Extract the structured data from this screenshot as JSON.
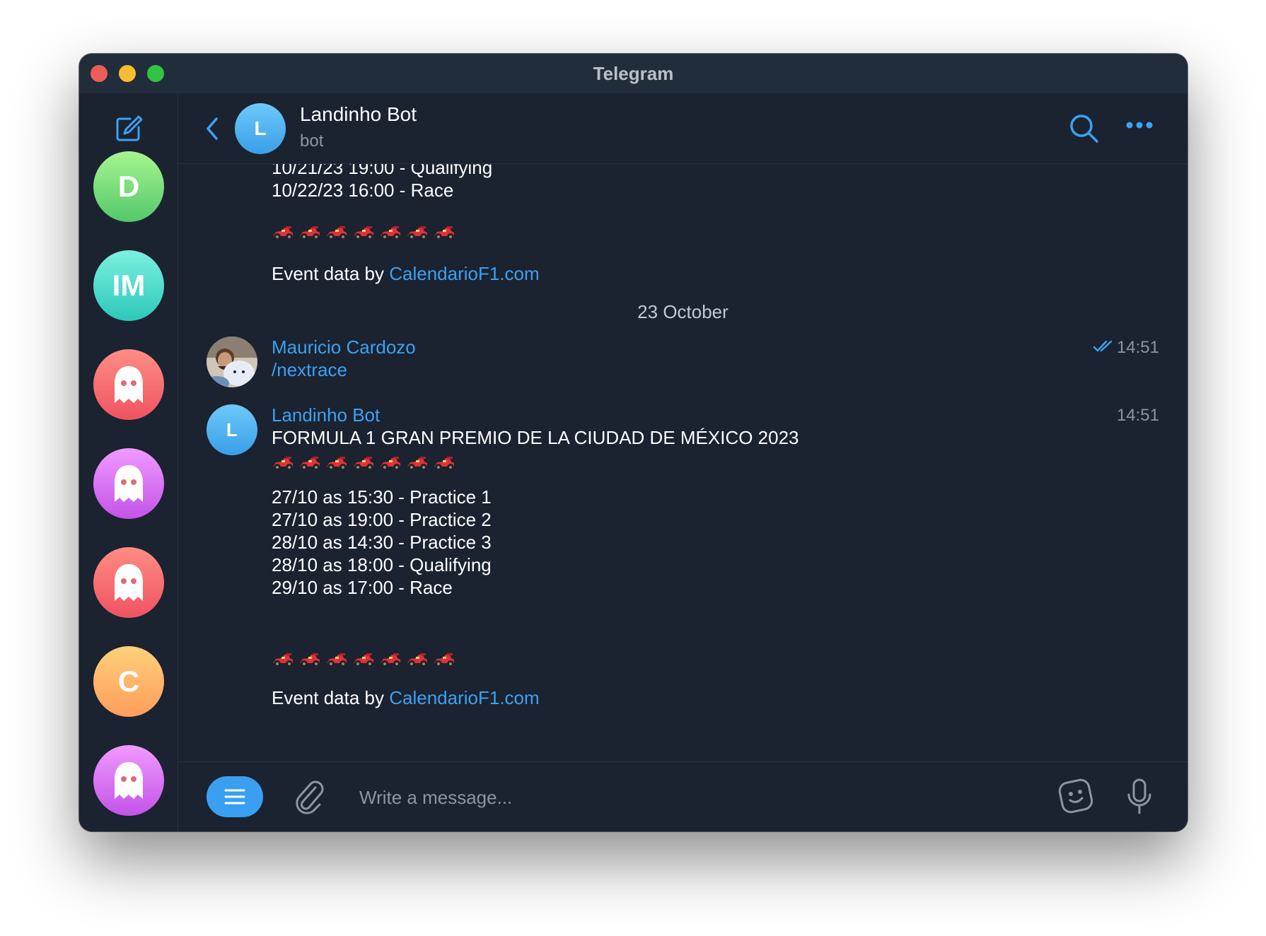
{
  "window": {
    "title": "Telegram"
  },
  "sidebar": {
    "chats": [
      {
        "initials": "D",
        "colors": [
          "#a6f58f",
          "#54c86a"
        ]
      },
      {
        "initials": "IM",
        "colors": [
          "#7cf0e0",
          "#2cc8b8"
        ]
      },
      {
        "initials": "",
        "icon": "ghost-icon",
        "colors": [
          "#ff8d84",
          "#ef5361"
        ]
      },
      {
        "initials": "",
        "icon": "ghost-icon",
        "colors": [
          "#f19aff",
          "#c353e8"
        ]
      },
      {
        "initials": "",
        "icon": "ghost-icon",
        "colors": [
          "#ff8d84",
          "#ef5361"
        ]
      },
      {
        "initials": "C",
        "colors": [
          "#ffd07a",
          "#ff9d5c"
        ]
      },
      {
        "initials": "",
        "icon": "ghost-icon",
        "colors": [
          "#f19aff",
          "#c353e8"
        ]
      }
    ]
  },
  "header": {
    "avatar_initial": "L",
    "name": "Landinho Bot",
    "subtitle": "bot"
  },
  "messages": {
    "previous_tail": {
      "lines": [
        "10/21/23 19:00 - Qualifying",
        "10/22/23 16:00 - Race"
      ],
      "emoji_count": 7,
      "credit_prefix": "Event data by ",
      "credit_link": "CalendarioF1.com"
    },
    "date_separator": "23 October",
    "user_message": {
      "sender": "Mauricio Cardozo",
      "text": "/nextrace",
      "time": "14:51",
      "status": "read"
    },
    "bot_message": {
      "sender": "Landinho Bot",
      "avatar_initial": "L",
      "time": "14:51",
      "title": "FORMULA 1 GRAN PREMIO DE LA CIUDAD DE MÉXICO 2023",
      "sessions": [
        "27/10 as 15:30 - Practice 1",
        "27/10 as 19:00 - Practice 2",
        "28/10 as 14:30 - Practice 3",
        "28/10 as 18:00 - Qualifying",
        "29/10 as 17:00 - Race"
      ],
      "credit_prefix": "Event data by ",
      "credit_link": "CalendarioF1.com"
    }
  },
  "composer": {
    "placeholder": "Write a message..."
  },
  "colors": {
    "accent": "#3aa2f3",
    "background": "#1b2230",
    "titlebar": "#222d3c"
  }
}
